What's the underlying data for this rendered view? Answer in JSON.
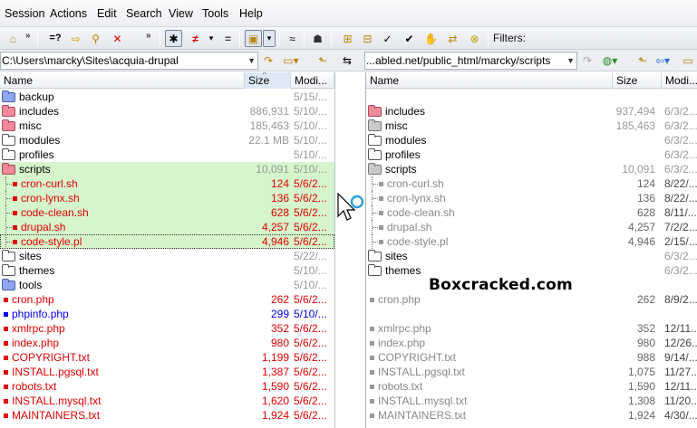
{
  "menu": [
    "Session",
    "Actions",
    "Edit",
    "Search",
    "View",
    "Tools",
    "Help"
  ],
  "toolbar": {
    "filters_label": "Filters:",
    "buttons": [
      {
        "name": "home-icon",
        "glyph": "⌂"
      },
      {
        "name": "chevron-right-icon",
        "glyph": "»"
      },
      {
        "name": "compare-equal-icon",
        "glyph": "=?"
      },
      {
        "name": "arrow-right-icon",
        "glyph": "⇨"
      },
      {
        "name": "search-icon",
        "glyph": "⚲"
      },
      {
        "name": "close-icon",
        "glyph": "✕"
      },
      {
        "name": "chevron-right-icon",
        "glyph": "»"
      },
      {
        "name": "show-all-icon",
        "glyph": "✱"
      },
      {
        "name": "show-differences-icon",
        "glyph": "≠"
      },
      {
        "name": "show-same-icon",
        "glyph": "="
      },
      {
        "name": "dropdown-icon",
        "glyph": "▾"
      },
      {
        "name": "folder-filter-icon",
        "glyph": "▣"
      },
      {
        "name": "dropdown-icon",
        "glyph": "▾"
      },
      {
        "name": "approx-icon",
        "glyph": "≈"
      },
      {
        "name": "person-icon",
        "glyph": "☗"
      },
      {
        "name": "tree-expand-icon",
        "glyph": "⊞"
      },
      {
        "name": "tree-collapse-icon",
        "glyph": "⊟"
      },
      {
        "name": "checkmark-icon",
        "glyph": "✓"
      },
      {
        "name": "checkmark-all-icon",
        "glyph": "✔"
      },
      {
        "name": "hand-icon",
        "glyph": "✋"
      },
      {
        "name": "cancel-circle-icon",
        "glyph": "⊗"
      }
    ]
  },
  "left_path": "C:\\Users\\marcky\\Sites\\acquia-drupal",
  "right_path": "...abled.net/public_html/marcky/scripts",
  "columns": {
    "name": "Name",
    "size": "Size",
    "modified": "Modi..."
  },
  "left_rows": [
    {
      "kind": "folder",
      "fcolor": "blue",
      "name": "backup",
      "size": "",
      "mod": "5/15/...",
      "color": "#000",
      "sizecolor": "#999",
      "modcolor": "#999",
      "indent": 0,
      "sel": false
    },
    {
      "kind": "folder",
      "fcolor": "red",
      "name": "includes",
      "size": "886,931",
      "mod": "5/10/...",
      "color": "#000",
      "sizecolor": "#999",
      "modcolor": "#999",
      "indent": 0,
      "sel": false
    },
    {
      "kind": "folder",
      "fcolor": "red",
      "name": "misc",
      "size": "185,463",
      "mod": "5/10/...",
      "color": "#000",
      "sizecolor": "#999",
      "modcolor": "#999",
      "indent": 0,
      "sel": false
    },
    {
      "kind": "folder",
      "fcolor": "white",
      "name": "modules",
      "size": "22.1 MB",
      "mod": "5/10/...",
      "color": "#000",
      "sizecolor": "#999",
      "modcolor": "#999",
      "indent": 0,
      "sel": false
    },
    {
      "kind": "folder",
      "fcolor": "white",
      "name": "profiles",
      "size": "",
      "mod": "5/10/...",
      "color": "#000",
      "sizecolor": "#999",
      "modcolor": "#999",
      "indent": 0,
      "sel": false
    },
    {
      "kind": "folder",
      "fcolor": "red",
      "name": "scripts",
      "size": "10,091",
      "mod": "5/10/...",
      "color": "#000",
      "sizecolor": "#999",
      "modcolor": "#999",
      "indent": 0,
      "sel": true
    },
    {
      "kind": "file",
      "sqcolor": "#e00000",
      "name": "cron-curl.sh",
      "size": "124",
      "mod": "5/6/2...",
      "color": "#e00000",
      "sizecolor": "#e00000",
      "modcolor": "#e00000",
      "indent": 1,
      "sel": true
    },
    {
      "kind": "file",
      "sqcolor": "#e00000",
      "name": "cron-lynx.sh",
      "size": "136",
      "mod": "5/6/2...",
      "color": "#e00000",
      "sizecolor": "#e00000",
      "modcolor": "#e00000",
      "indent": 1,
      "sel": true
    },
    {
      "kind": "file",
      "sqcolor": "#e00000",
      "name": "code-clean.sh",
      "size": "628",
      "mod": "5/6/2...",
      "color": "#e00000",
      "sizecolor": "#e00000",
      "modcolor": "#e00000",
      "indent": 1,
      "sel": true
    },
    {
      "kind": "file",
      "sqcolor": "#e00000",
      "name": "drupal.sh",
      "size": "4,257",
      "mod": "5/6/2...",
      "color": "#e00000",
      "sizecolor": "#e00000",
      "modcolor": "#e00000",
      "indent": 1,
      "sel": true
    },
    {
      "kind": "file",
      "sqcolor": "#e00000",
      "name": "code-style.pl",
      "size": "4,946",
      "mod": "5/6/2...",
      "color": "#e00000",
      "sizecolor": "#e00000",
      "modcolor": "#e00000",
      "indent": 1,
      "sel": true,
      "focused": true
    },
    {
      "kind": "folder",
      "fcolor": "white",
      "name": "sites",
      "size": "",
      "mod": "5/22/...",
      "color": "#000",
      "sizecolor": "#999",
      "modcolor": "#999",
      "indent": 0,
      "sel": false
    },
    {
      "kind": "folder",
      "fcolor": "white",
      "name": "themes",
      "size": "",
      "mod": "5/10/...",
      "color": "#000",
      "sizecolor": "#999",
      "modcolor": "#999",
      "indent": 0,
      "sel": false
    },
    {
      "kind": "folder",
      "fcolor": "blue",
      "name": "tools",
      "size": "",
      "mod": "5/10/...",
      "color": "#000",
      "sizecolor": "#999",
      "modcolor": "#999",
      "indent": 0,
      "sel": false
    },
    {
      "kind": "file",
      "sqcolor": "#e00000",
      "name": "cron.php",
      "size": "262",
      "mod": "5/6/2...",
      "color": "#e00000",
      "sizecolor": "#e00000",
      "modcolor": "#e00000",
      "indent": 0,
      "sel": false
    },
    {
      "kind": "file",
      "sqcolor": "#0000e0",
      "name": "phpinfo.php",
      "size": "299",
      "mod": "5/10/...",
      "color": "#0000e0",
      "sizecolor": "#0000e0",
      "modcolor": "#0000e0",
      "indent": 0,
      "sel": false
    },
    {
      "kind": "file",
      "sqcolor": "#e00000",
      "name": "xmlrpc.php",
      "size": "352",
      "mod": "5/6/2...",
      "color": "#e00000",
      "sizecolor": "#e00000",
      "modcolor": "#e00000",
      "indent": 0,
      "sel": false
    },
    {
      "kind": "file",
      "sqcolor": "#e00000",
      "name": "index.php",
      "size": "980",
      "mod": "5/6/2...",
      "color": "#e00000",
      "sizecolor": "#e00000",
      "modcolor": "#e00000",
      "indent": 0,
      "sel": false
    },
    {
      "kind": "file",
      "sqcolor": "#e00000",
      "name": "COPYRIGHT.txt",
      "size": "1,199",
      "mod": "5/6/2...",
      "color": "#e00000",
      "sizecolor": "#e00000",
      "modcolor": "#e00000",
      "indent": 0,
      "sel": false
    },
    {
      "kind": "file",
      "sqcolor": "#e00000",
      "name": "INSTALL.pgsql.txt",
      "size": "1,387",
      "mod": "5/6/2...",
      "color": "#e00000",
      "sizecolor": "#e00000",
      "modcolor": "#e00000",
      "indent": 0,
      "sel": false
    },
    {
      "kind": "file",
      "sqcolor": "#e00000",
      "name": "robots.txt",
      "size": "1,590",
      "mod": "5/6/2...",
      "color": "#e00000",
      "sizecolor": "#e00000",
      "modcolor": "#e00000",
      "indent": 0,
      "sel": false
    },
    {
      "kind": "file",
      "sqcolor": "#e00000",
      "name": "INSTALL.mysql.txt",
      "size": "1,620",
      "mod": "5/6/2...",
      "color": "#e00000",
      "sizecolor": "#e00000",
      "modcolor": "#e00000",
      "indent": 0,
      "sel": false
    },
    {
      "kind": "file",
      "sqcolor": "#e00000",
      "name": "MAINTAINERS.txt",
      "size": "1,924",
      "mod": "5/6/2...",
      "color": "#e00000",
      "sizecolor": "#e00000",
      "modcolor": "#e00000",
      "indent": 0,
      "sel": false
    }
  ],
  "right_rows": [
    {
      "kind": "blank"
    },
    {
      "kind": "folder",
      "fcolor": "red",
      "name": "includes",
      "size": "937,494",
      "mod": "6/3/2...",
      "color": "#000",
      "sizecolor": "#999",
      "modcolor": "#999",
      "indent": 0
    },
    {
      "kind": "folder",
      "fcolor": "grey",
      "name": "misc",
      "size": "185,463",
      "mod": "6/3/2...",
      "color": "#000",
      "sizecolor": "#999",
      "modcolor": "#999",
      "indent": 0
    },
    {
      "kind": "folder",
      "fcolor": "white",
      "name": "modules",
      "size": "",
      "mod": "6/3/2...",
      "color": "#000",
      "sizecolor": "#999",
      "modcolor": "#999",
      "indent": 0
    },
    {
      "kind": "folder",
      "fcolor": "white",
      "name": "profiles",
      "size": "",
      "mod": "6/3/2...",
      "color": "#000",
      "sizecolor": "#999",
      "modcolor": "#999",
      "indent": 0
    },
    {
      "kind": "folder",
      "fcolor": "grey",
      "name": "scripts",
      "size": "10,091",
      "mod": "6/3/2...",
      "color": "#000",
      "sizecolor": "#999",
      "modcolor": "#999",
      "indent": 0
    },
    {
      "kind": "file",
      "sqcolor": "#999",
      "name": "cron-curl.sh",
      "size": "124",
      "mod": "8/22/...",
      "color": "#888",
      "sizecolor": "#666",
      "modcolor": "#444",
      "indent": 1
    },
    {
      "kind": "file",
      "sqcolor": "#999",
      "name": "cron-lynx.sh",
      "size": "136",
      "mod": "8/22/...",
      "color": "#888",
      "sizecolor": "#666",
      "modcolor": "#444",
      "indent": 1
    },
    {
      "kind": "file",
      "sqcolor": "#999",
      "name": "code-clean.sh",
      "size": "628",
      "mod": "8/11/...",
      "color": "#888",
      "sizecolor": "#666",
      "modcolor": "#444",
      "indent": 1
    },
    {
      "kind": "file",
      "sqcolor": "#999",
      "name": "drupal.sh",
      "size": "4,257",
      "mod": "7/2/2...",
      "color": "#888",
      "sizecolor": "#666",
      "modcolor": "#444",
      "indent": 1
    },
    {
      "kind": "file",
      "sqcolor": "#999",
      "name": "code-style.pl",
      "size": "4,946",
      "mod": "2/15/...",
      "color": "#888",
      "sizecolor": "#666",
      "modcolor": "#444",
      "indent": 1
    },
    {
      "kind": "folder",
      "fcolor": "white",
      "name": "sites",
      "size": "",
      "mod": "6/3/2...",
      "color": "#000",
      "sizecolor": "#999",
      "modcolor": "#999",
      "indent": 0
    },
    {
      "kind": "folder",
      "fcolor": "white",
      "name": "themes",
      "size": "",
      "mod": "6/3/2...",
      "color": "#000",
      "sizecolor": "#999",
      "modcolor": "#999",
      "indent": 0
    },
    {
      "kind": "blank"
    },
    {
      "kind": "file",
      "sqcolor": "#999",
      "name": "cron.php",
      "size": "262",
      "mod": "8/9/2...",
      "color": "#888",
      "sizecolor": "#666",
      "modcolor": "#444",
      "indent": 0
    },
    {
      "kind": "blank"
    },
    {
      "kind": "file",
      "sqcolor": "#999",
      "name": "xmlrpc.php",
      "size": "352",
      "mod": "12/11...",
      "color": "#888",
      "sizecolor": "#666",
      "modcolor": "#444",
      "indent": 0
    },
    {
      "kind": "file",
      "sqcolor": "#999",
      "name": "index.php",
      "size": "980",
      "mod": "12/26...",
      "color": "#888",
      "sizecolor": "#666",
      "modcolor": "#444",
      "indent": 0
    },
    {
      "kind": "file",
      "sqcolor": "#999",
      "name": "COPYRIGHT.txt",
      "size": "988",
      "mod": "9/14/...",
      "color": "#888",
      "sizecolor": "#666",
      "modcolor": "#444",
      "indent": 0
    },
    {
      "kind": "file",
      "sqcolor": "#999",
      "name": "INSTALL.pgsql.txt",
      "size": "1,075",
      "mod": "11/27...",
      "color": "#888",
      "sizecolor": "#666",
      "modcolor": "#444",
      "indent": 0
    },
    {
      "kind": "file",
      "sqcolor": "#999",
      "name": "robots.txt",
      "size": "1,590",
      "mod": "12/11...",
      "color": "#888",
      "sizecolor": "#666",
      "modcolor": "#444",
      "indent": 0
    },
    {
      "kind": "file",
      "sqcolor": "#999",
      "name": "INSTALL.mysql.txt",
      "size": "1,308",
      "mod": "11/20...",
      "color": "#888",
      "sizecolor": "#666",
      "modcolor": "#444",
      "indent": 0
    },
    {
      "kind": "file",
      "sqcolor": "#999",
      "name": "MAINTAINERS.txt",
      "size": "1,924",
      "mod": "4/30/...",
      "color": "#888",
      "sizecolor": "#666",
      "modcolor": "#444",
      "indent": 0
    }
  ],
  "watermark": "Boxcracked.com"
}
